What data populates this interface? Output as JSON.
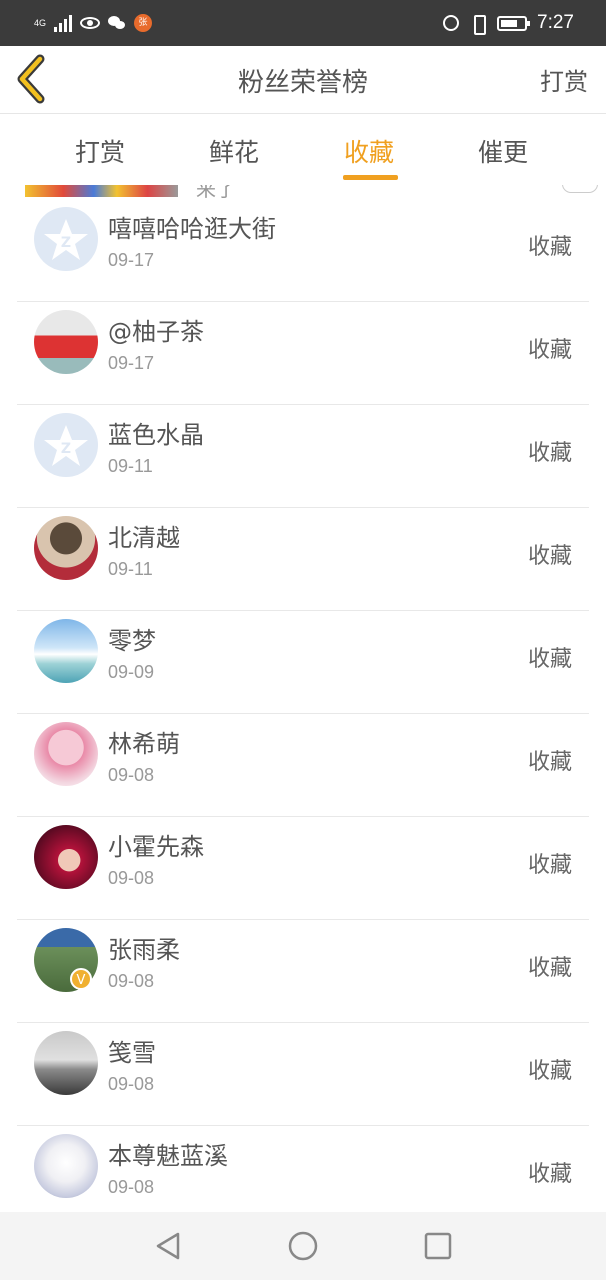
{
  "status_bar": {
    "network": "4G",
    "app_badge": "张",
    "time": "7:27"
  },
  "header": {
    "title": "粉丝荣誉榜",
    "action": "打赏"
  },
  "tabs": [
    {
      "label": "打赏",
      "active": false
    },
    {
      "label": "鲜花",
      "active": false
    },
    {
      "label": "收藏",
      "active": true
    },
    {
      "label": "催更",
      "active": false
    }
  ],
  "peek_row": {
    "text": "来了"
  },
  "list": [
    {
      "name": "嘻嘻哈哈逛大街",
      "date": "09-17",
      "action": "收藏",
      "avatar": "default-avatar"
    },
    {
      "name": "@柚子茶",
      "date": "09-17",
      "action": "收藏",
      "avatar": "photo-avatar"
    },
    {
      "name": "蓝色水晶",
      "date": "09-11",
      "action": "收藏",
      "avatar": "default-avatar"
    },
    {
      "name": "北清越",
      "date": "09-11",
      "action": "收藏",
      "avatar": "photo-avatar"
    },
    {
      "name": "零梦",
      "date": "09-09",
      "action": "收藏",
      "avatar": "photo-avatar"
    },
    {
      "name": "林希萌",
      "date": "09-08",
      "action": "收藏",
      "avatar": "photo-avatar"
    },
    {
      "name": "小霍先森",
      "date": "09-08",
      "action": "收藏",
      "avatar": "photo-avatar"
    },
    {
      "name": "张雨柔",
      "date": "09-08",
      "action": "收藏",
      "avatar": "photo-avatar",
      "badge": "V"
    },
    {
      "name": "笺雪",
      "date": "09-08",
      "action": "收藏",
      "avatar": "photo-avatar"
    },
    {
      "name": "本尊魅蓝溪",
      "date": "09-08",
      "action": "收藏",
      "avatar": "photo-avatar"
    }
  ],
  "colors": {
    "accent": "#f0a020",
    "status_bar_bg": "#3b3b3b",
    "text_primary": "#555555",
    "text_secondary": "#999999"
  }
}
